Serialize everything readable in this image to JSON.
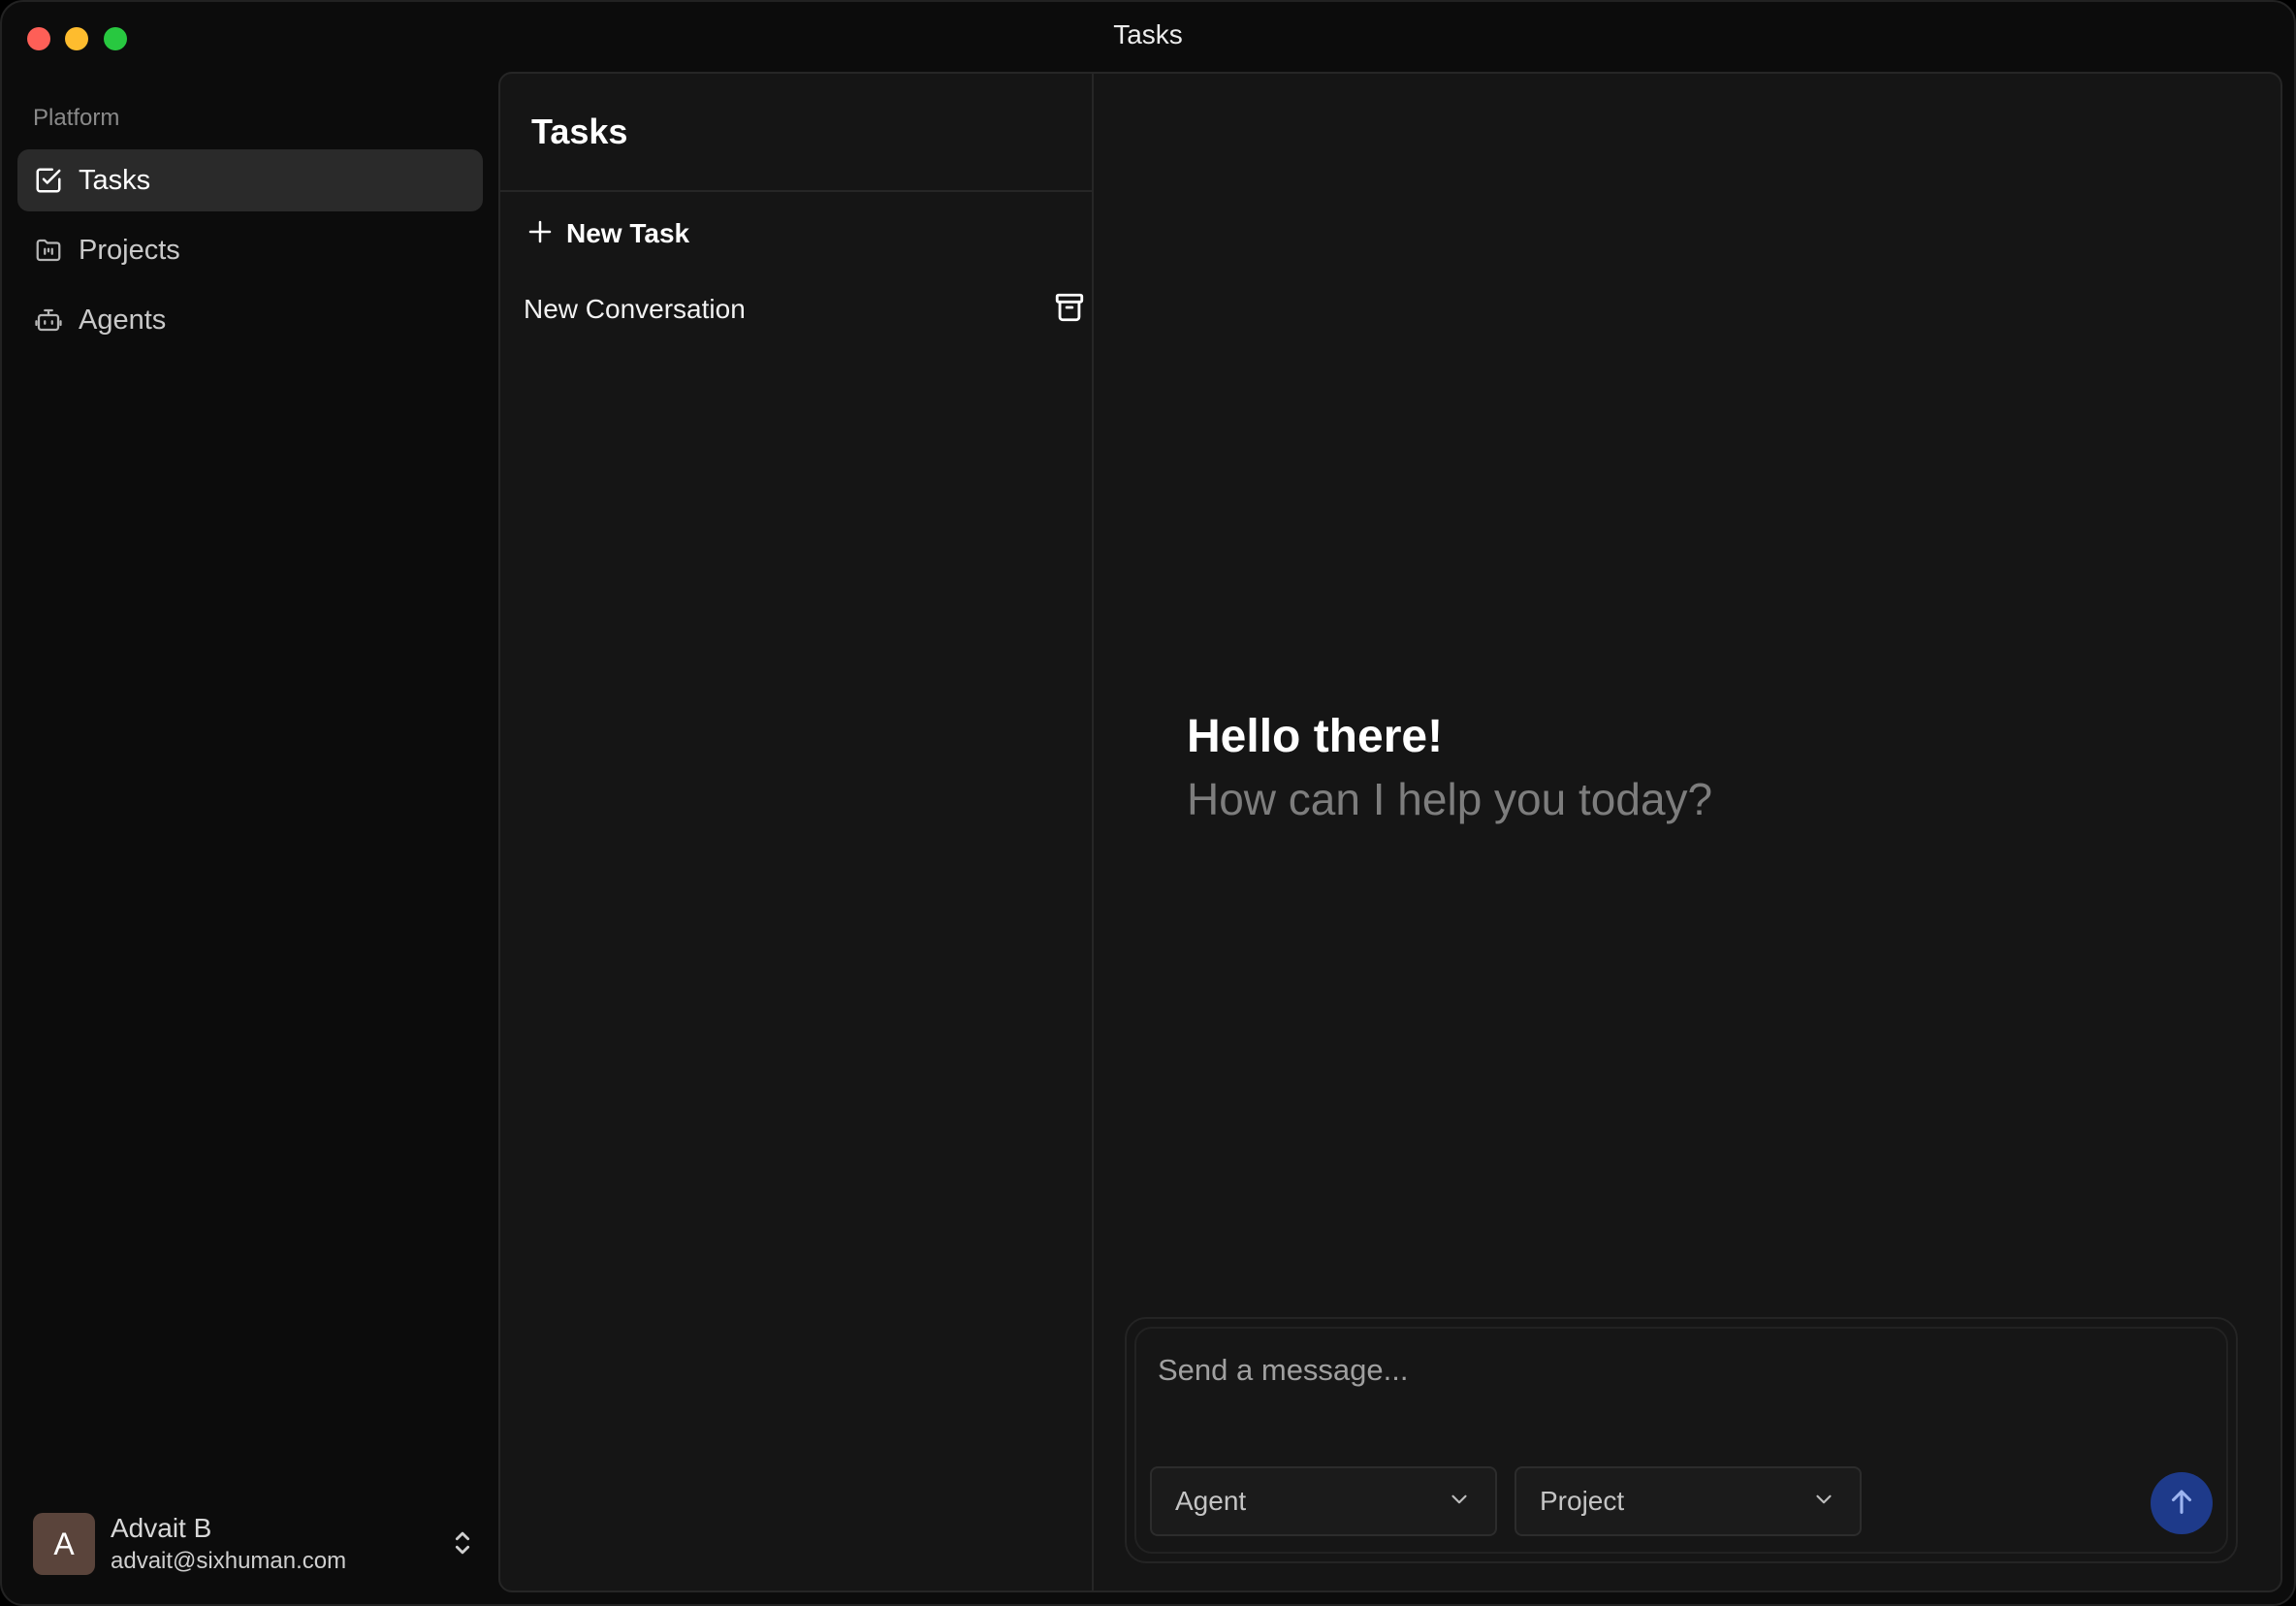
{
  "window": {
    "title": "Tasks"
  },
  "sidebar": {
    "section_label": "Platform",
    "items": [
      {
        "label": "Tasks",
        "icon": "checkbox-icon",
        "active": true
      },
      {
        "label": "Projects",
        "icon": "folder-icon",
        "active": false
      },
      {
        "label": "Agents",
        "icon": "robot-icon",
        "active": false
      }
    ],
    "user": {
      "initial": "A",
      "name": "Advait B",
      "email": "advait@sixhuman.com"
    }
  },
  "task_list": {
    "title": "Tasks",
    "new_task_label": "New Task",
    "conversations": [
      {
        "label": "New Conversation"
      }
    ]
  },
  "chat": {
    "greeting_title": "Hello there!",
    "greeting_subtitle": "How can I help you today?",
    "input_placeholder": "Send a message...",
    "agent_select": "Agent",
    "project_select": "Project"
  },
  "colors": {
    "send_button": "#1e3a8a",
    "active_nav": "#2a2a2a",
    "avatar": "#5a443b"
  }
}
